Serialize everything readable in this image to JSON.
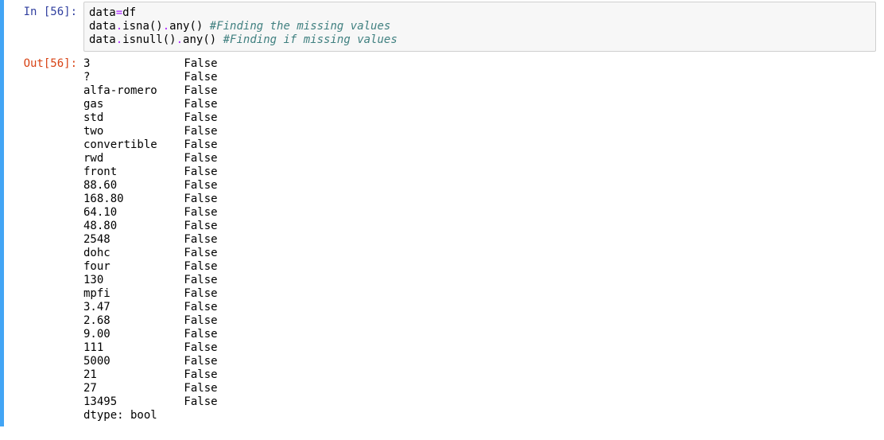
{
  "prompts": {
    "in_label": "In [56]:",
    "out_label": "Out[56]:"
  },
  "code": {
    "line1_lhs": "data",
    "line1_op": "=",
    "line1_rhs": "df",
    "line2_pre": "data",
    "line2_dot1": ".",
    "line2_m1": "isna",
    "line2_par1": "()",
    "line2_dot2": ".",
    "line2_m2": "any",
    "line2_par2": "()",
    "line2_space": " ",
    "line2_comment": "#Finding the missing values",
    "line3_pre": "data",
    "line3_dot1": ".",
    "line3_m1": "isnull",
    "line3_par1": "()",
    "line3_dot2": ".",
    "line3_m2": "any",
    "line3_par2": "()",
    "line3_space": " ",
    "line3_comment": "#Finding if missing values"
  },
  "output": {
    "rows": [
      {
        "key": "3",
        "val": "False"
      },
      {
        "key": "?",
        "val": "False"
      },
      {
        "key": "alfa-romero",
        "val": "False"
      },
      {
        "key": "gas",
        "val": "False"
      },
      {
        "key": "std",
        "val": "False"
      },
      {
        "key": "two",
        "val": "False"
      },
      {
        "key": "convertible",
        "val": "False"
      },
      {
        "key": "rwd",
        "val": "False"
      },
      {
        "key": "front",
        "val": "False"
      },
      {
        "key": "88.60",
        "val": "False"
      },
      {
        "key": "168.80",
        "val": "False"
      },
      {
        "key": "64.10",
        "val": "False"
      },
      {
        "key": "48.80",
        "val": "False"
      },
      {
        "key": "2548",
        "val": "False"
      },
      {
        "key": "dohc",
        "val": "False"
      },
      {
        "key": "four",
        "val": "False"
      },
      {
        "key": "130",
        "val": "False"
      },
      {
        "key": "mpfi",
        "val": "False"
      },
      {
        "key": "3.47",
        "val": "False"
      },
      {
        "key": "2.68",
        "val": "False"
      },
      {
        "key": "9.00",
        "val": "False"
      },
      {
        "key": "111",
        "val": "False"
      },
      {
        "key": "5000",
        "val": "False"
      },
      {
        "key": "21",
        "val": "False"
      },
      {
        "key": "27",
        "val": "False"
      },
      {
        "key": "13495",
        "val": "False"
      }
    ],
    "dtype_line": "dtype: bool"
  }
}
